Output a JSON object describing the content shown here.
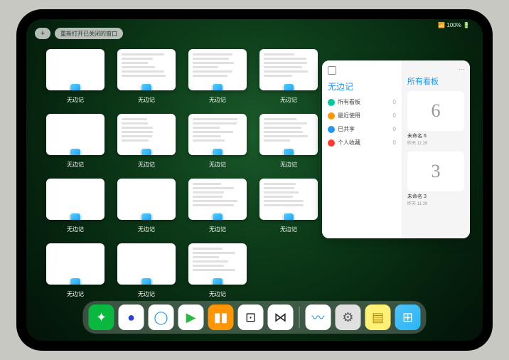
{
  "status": {
    "indicators": "📶 100% 🔋"
  },
  "topbar": {
    "plus": "+",
    "reopen": "重新打开已关闭的窗口"
  },
  "app_grid": {
    "label": "无边记",
    "items": [
      {
        "variant": "blank"
      },
      {
        "variant": "lines"
      },
      {
        "variant": "lines"
      },
      {
        "variant": "lines"
      },
      {
        "variant": "blank"
      },
      {
        "variant": "lines"
      },
      {
        "variant": "lines"
      },
      {
        "variant": "lines"
      },
      {
        "variant": "blank"
      },
      {
        "variant": "blank"
      },
      {
        "variant": "lines"
      },
      {
        "variant": "lines"
      },
      {
        "variant": "blank"
      },
      {
        "variant": "blank"
      },
      {
        "variant": "lines"
      }
    ]
  },
  "sidepanel": {
    "left": {
      "title": "无边记",
      "rows": [
        {
          "label": "所有看板",
          "count": "0",
          "color": "#00c8a0"
        },
        {
          "label": "最近使用",
          "count": "0",
          "color": "#ff9800"
        },
        {
          "label": "已共享",
          "count": "0",
          "color": "#2196f3"
        },
        {
          "label": "个人收藏",
          "count": "0",
          "color": "#ff3b30"
        }
      ]
    },
    "right": {
      "title": "所有看板",
      "more": "⋯",
      "boards": [
        {
          "glyph": "6",
          "name": "未命名 6",
          "date": "昨天 11:26"
        },
        {
          "glyph": "3",
          "name": "未命名 3",
          "date": "昨天 11:26"
        }
      ]
    }
  },
  "dock": {
    "apps": [
      {
        "name": "wechat",
        "bg": "#09b83e",
        "glyph": "✦",
        "color": "#fff"
      },
      {
        "name": "quark-hd",
        "bg": "#fff",
        "glyph": "●",
        "color": "#2b3fe0"
      },
      {
        "name": "quark",
        "bg": "#fff",
        "glyph": "◯",
        "color": "#2196f3"
      },
      {
        "name": "media",
        "bg": "#fff",
        "glyph": "▶",
        "color": "#2cb742"
      },
      {
        "name": "books",
        "bg": "#ff9500",
        "glyph": "▮▮",
        "color": "#fff"
      },
      {
        "name": "dice",
        "bg": "#fff",
        "glyph": "⊡",
        "color": "#222"
      },
      {
        "name": "graph",
        "bg": "#fff",
        "glyph": "⋈",
        "color": "#222"
      }
    ],
    "recent": [
      {
        "name": "freeform",
        "bg": "#fff",
        "glyph": "〰",
        "color": "#2196f3"
      },
      {
        "name": "settings",
        "bg": "#e0e0e0",
        "glyph": "⚙",
        "color": "#555"
      },
      {
        "name": "notes",
        "bg": "#fff176",
        "glyph": "▤",
        "color": "#b88a00"
      },
      {
        "name": "app-library",
        "bg": "linear-gradient(135deg,#4fc3f7,#29b6f6)",
        "glyph": "⊞",
        "color": "#fff"
      }
    ]
  }
}
